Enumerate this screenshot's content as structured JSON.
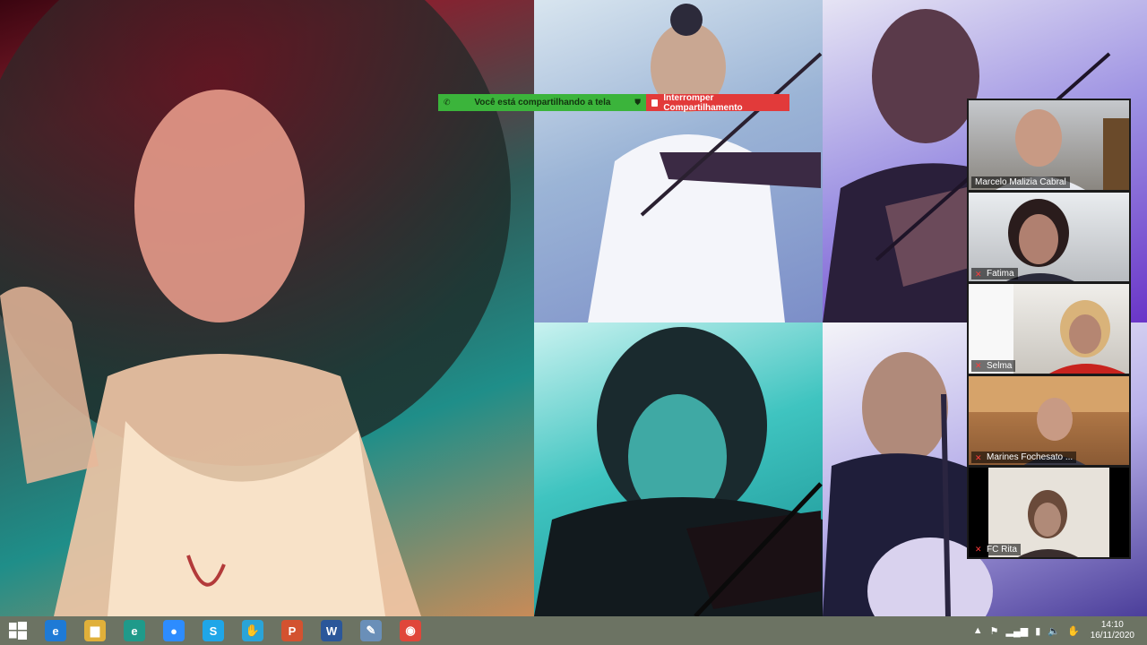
{
  "share_banner": {
    "status_text": "Você está compartilhando a tela",
    "stop_label": "Interromper Compartilhamento"
  },
  "participants": [
    {
      "name": "Marcelo Malizia Cabral",
      "muted": false
    },
    {
      "name": "Fatima",
      "muted": true
    },
    {
      "name": "Selma",
      "muted": true
    },
    {
      "name": "Marines Fochesato ...",
      "muted": true
    },
    {
      "name": "FC Rita",
      "muted": true
    }
  ],
  "taskbar": {
    "apps": [
      {
        "icon": "internet-explorer-icon",
        "glyph": "e",
        "color": "#1e7ad6"
      },
      {
        "icon": "file-explorer-icon",
        "glyph": "▆",
        "color": "#e0b03a"
      },
      {
        "icon": "edge-icon",
        "glyph": "e",
        "color": "#1f9a8a"
      },
      {
        "icon": "zoom-icon",
        "glyph": "●",
        "color": "#2d8cff"
      },
      {
        "icon": "skype-icon",
        "glyph": "S",
        "color": "#1fa6e8"
      },
      {
        "icon": "paw-app-icon",
        "glyph": "✋",
        "color": "#2aa4d8"
      },
      {
        "icon": "powerpoint-document-icon",
        "glyph": "P",
        "color": "#d35230"
      },
      {
        "icon": "word-document-icon",
        "glyph": "W",
        "color": "#2b579a"
      },
      {
        "icon": "paint-icon",
        "glyph": "✎",
        "color": "#6a8fb8"
      },
      {
        "icon": "chrome-icon",
        "glyph": "◉",
        "color": "#e0463a"
      }
    ],
    "clock": {
      "time": "14:10",
      "date": "16/11/2020"
    }
  }
}
